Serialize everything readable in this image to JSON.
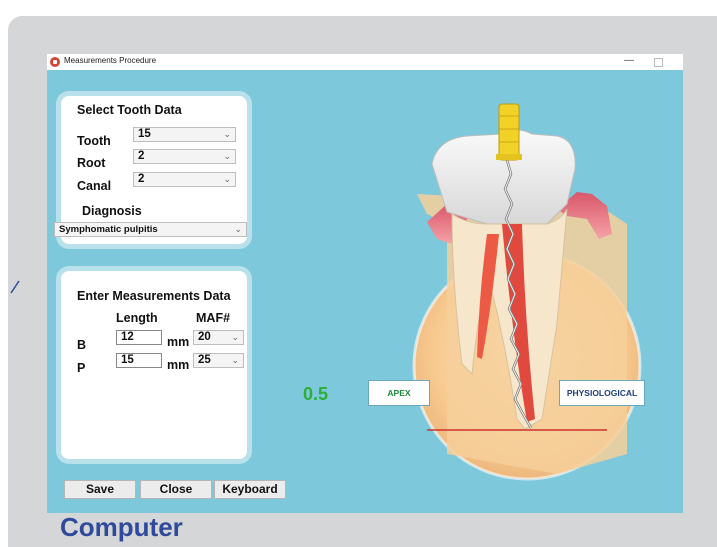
{
  "window": {
    "title": "Measurements Procedure",
    "minimize_glyph": "—",
    "maximize_icon": "maximize-icon"
  },
  "select_tooth": {
    "heading": "Select Tooth Data",
    "tooth": {
      "label": "Tooth",
      "value": "15"
    },
    "root": {
      "label": "Root",
      "value": "2"
    },
    "canal": {
      "label": "Canal",
      "value": "2"
    },
    "diagnosis": {
      "label": "Diagnosis",
      "value": "Symphomatic pulpitis"
    }
  },
  "measurements": {
    "heading": "Enter Measurements Data",
    "col_length": "Length",
    "col_maf": "MAF#",
    "rows": [
      {
        "label": "B",
        "length": "12",
        "unit": "mm",
        "maf": "20"
      },
      {
        "label": "P",
        "length": "15",
        "unit": "mm",
        "maf": "25"
      }
    ]
  },
  "buttons": {
    "save": "Save",
    "close": "Close",
    "keyboard": "Keyboard"
  },
  "illustration": {
    "readout": "0.5",
    "apex_label": "APEX",
    "physiological_label": "PHYSIOLOGICAL"
  },
  "caption": "Computer",
  "colors": {
    "window_bg": "#7ec8dc",
    "readout": "#2fae3a",
    "caption": "#2f4a9a",
    "instrument_handle": "#f2d226"
  }
}
